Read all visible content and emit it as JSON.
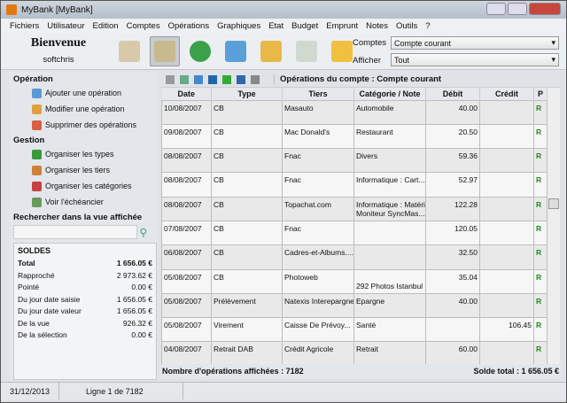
{
  "window": {
    "title": "MyBank [MyBank]",
    "controls": [
      "minimize",
      "maximize",
      "close"
    ]
  },
  "menu": [
    "Fichiers",
    "Utilisateur",
    "Edition",
    "Comptes",
    "Opérations",
    "Graphiques",
    "Etat",
    "Budget",
    "Emprunt",
    "Notes",
    "Outils",
    "?"
  ],
  "toolbar": {
    "welcome": "Bienvenue",
    "user": "softchris",
    "icons": [
      "home-icon",
      "book-icon",
      "pie-chart-icon",
      "list-icon",
      "coins-icon",
      "line-chart-icon",
      "notes-icon"
    ],
    "comptes_label": "Comptes",
    "comptes_value": "Compte courant",
    "afficher_label": "Afficher",
    "afficher_value": "Tout"
  },
  "sidebar": {
    "operation_title": "Opération",
    "operation_items": [
      "Ajouter une opération",
      "Modifier une opération",
      "Supprimer des opérations"
    ],
    "gestion_title": "Gestion",
    "gestion_items": [
      "Organiser les types",
      "Organiser les tiers",
      "Organiser les catégories",
      "Voir l'échéancier"
    ],
    "search_label": "Rechercher dans la vue affichée",
    "search_value": "",
    "soldes_title": "SOLDES",
    "soldes": [
      {
        "label": "Total",
        "value": "1 656.05 €"
      },
      {
        "label": "Rapproché",
        "value": "2 973.62 €"
      },
      {
        "label": "Pointé",
        "value": "0.00 €"
      },
      {
        "label": "Du jour date saisie",
        "value": "1 656.05 €"
      },
      {
        "label": "Du jour date valeur",
        "value": "1 656.05 €"
      },
      {
        "label": "De la vue",
        "value": "926.32 €"
      },
      {
        "label": "De la sélection",
        "value": "0.00 €"
      }
    ]
  },
  "main": {
    "tool_icons": [
      "filter-icon",
      "search-icon",
      "copy-icon",
      "card-icon",
      "excel-icon",
      "pin-icon",
      "calculator-icon"
    ],
    "title": "Opérations du compte : Compte courant",
    "columns": [
      "Date",
      "Type",
      "Tiers",
      "Catégorie / Note",
      "Débit",
      "Crédit",
      "P"
    ],
    "rows": [
      [
        "10/08/2007",
        "CB",
        "Masauto",
        "Automobile",
        "40.00",
        "",
        "R"
      ],
      [
        "09/08/2007",
        "CB",
        "Mac Donald's",
        "Restaurant",
        "20.50",
        "",
        "R"
      ],
      [
        "08/08/2007",
        "CB",
        "Fnac",
        "Divers",
        "59.36",
        "",
        "R"
      ],
      [
        "08/08/2007",
        "CB",
        "Fnac",
        "Informatique : Cart...",
        "52.97",
        "",
        "R"
      ],
      [
        "08/08/2007",
        "CB",
        "Topachat.com",
        "Informatique : Matéri\nMoniteur SyncMas...",
        "122.28",
        "",
        "R"
      ],
      [
        "07/08/2007",
        "CB",
        "Fnac",
        "",
        "120.05",
        "",
        "R"
      ],
      [
        "06/08/2007",
        "CB",
        "Cadres-et-Albums....",
        "",
        "32.50",
        "",
        "R"
      ],
      [
        "05/08/2007",
        "CB",
        "Photoweb",
        "\n292 Photos Istanbul",
        "35.04",
        "",
        "R"
      ],
      [
        "05/08/2007",
        "Prélèvement",
        "Natexis Interepargne",
        "Epargne",
        "40.00",
        "",
        "R"
      ],
      [
        "05/08/2007",
        "Virement",
        "Caisse De Prévoy...",
        "Santé",
        "",
        "106.45",
        "R"
      ],
      [
        "04/08/2007",
        "Retrait DAB",
        "Crédit Agricole",
        "Retrait",
        "60.00",
        "",
        "R"
      ]
    ],
    "footer_count": "Nombre d'opérations affichées : 7182",
    "footer_total": "Solde total : 1 656.05 €"
  },
  "status": {
    "date": "31/12/2013",
    "line": "Ligne 1 de 7182"
  }
}
